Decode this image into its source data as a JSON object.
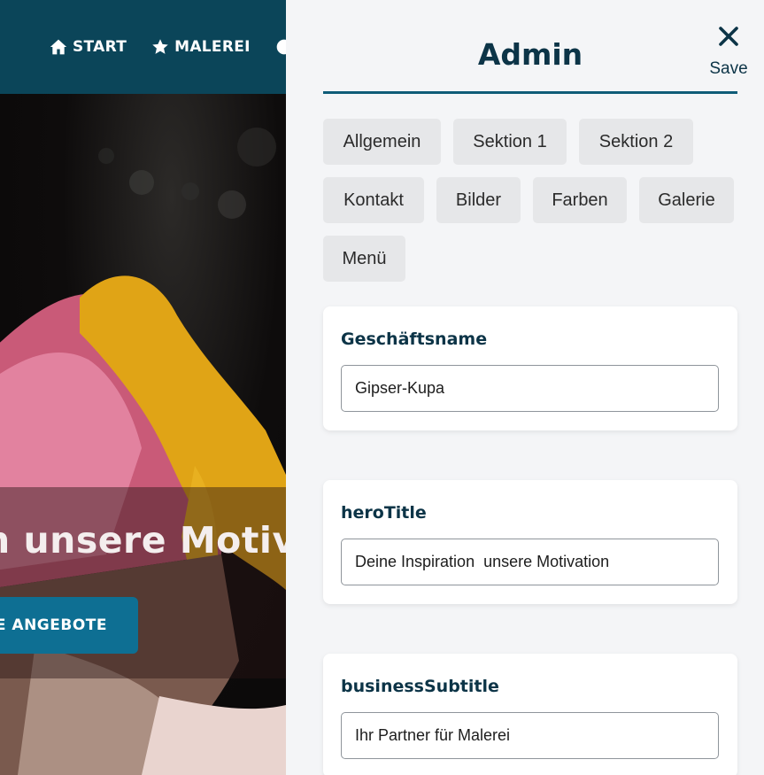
{
  "site": {
    "nav": [
      {
        "label": "START",
        "icon": "home-icon"
      },
      {
        "label": "MALEREI",
        "icon": "star-icon"
      }
    ],
    "hero_title_visible": "n unsere Motiva",
    "hero_button_visible": "E ANGEBOTE",
    "colors": {
      "nav_bg": "#0b4559",
      "button_bg": "#0e6f93"
    }
  },
  "admin": {
    "title": "Admin",
    "close": {
      "icon": "close-icon",
      "label": "Save"
    },
    "tabs": [
      "Allgemein",
      "Sektion 1",
      "Sektion 2",
      "Kontakt",
      "Bilder",
      "Farben",
      "Galerie",
      "Menü"
    ],
    "fields": [
      {
        "label": "Geschäftsname",
        "value": "Gipser-Kupa"
      },
      {
        "label": "heroTitle",
        "value": "Deine Inspiration  unsere Motivation"
      },
      {
        "label": "businessSubtitle",
        "value": "Ihr Partner für Malerei"
      }
    ],
    "colors": {
      "accent": "#0e5c78",
      "heading": "#0c3447",
      "panel_bg": "#f4f5f7",
      "tab_bg": "#e6e7e9"
    }
  }
}
